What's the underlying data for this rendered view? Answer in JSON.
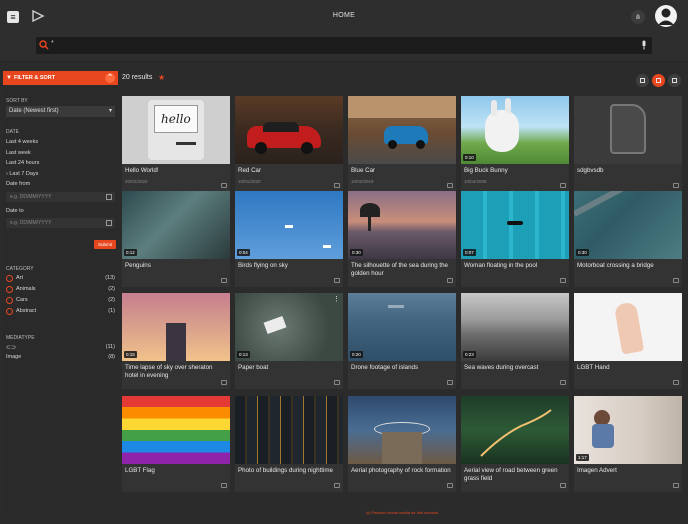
{
  "header": {
    "title": "HOME",
    "menu_icon": "hamburger-icon",
    "logo_icon": "play-logo-icon"
  },
  "search": {
    "value": "*",
    "placeholder": ""
  },
  "sidebar": {
    "panel_title": "FILTER & SORT",
    "sort_label": "SORT BY",
    "sort_value": "Date (Newest first)",
    "date_label": "DATE",
    "date_options": [
      "Last 4 weeks",
      "Last week",
      "Last 24 hours",
      "Last 7 Days"
    ],
    "date_from_label": "Date from",
    "date_from_placeholder": "e.g. DD/MM/YYYY",
    "date_to_label": "Date to",
    "date_to_placeholder": "e.g. DD/MM/YYYY",
    "submit_label": "Submit",
    "category_label": "CATEGORY",
    "categories": [
      {
        "name": "Art",
        "count": "(13)"
      },
      {
        "name": "Animals",
        "count": "(2)"
      },
      {
        "name": "Cars",
        "count": "(2)"
      },
      {
        "name": "Abstract",
        "count": "(1)"
      }
    ],
    "mediatype_label": "MEDIATYPE",
    "mediatypes": [
      {
        "name": "",
        "count": "(11)"
      },
      {
        "name": "Image",
        "count": "(8)"
      }
    ]
  },
  "main": {
    "results_count": "20 results",
    "cards": [
      {
        "title": "Hello World!",
        "date": "20/02/2020",
        "duration": "",
        "type": "image"
      },
      {
        "title": "Red Car",
        "date": "10/01/2020",
        "duration": "",
        "type": "image"
      },
      {
        "title": "Blue Car",
        "date": "10/02/2019",
        "duration": "",
        "type": "image"
      },
      {
        "title": "Big Buck Bunny",
        "date": "10/04/2008",
        "duration": "0:10",
        "type": "video"
      },
      {
        "title": "sdgbvsdb",
        "date": "",
        "duration": "",
        "type": "video"
      },
      {
        "title": "Penguins",
        "date": "",
        "duration": "0:12",
        "type": "video"
      },
      {
        "title": "Birds flying on sky",
        "date": "",
        "duration": "0:04",
        "type": "video"
      },
      {
        "title": "The silhouette of the sea during the golden hour",
        "date": "",
        "duration": "0:30",
        "type": "video"
      },
      {
        "title": "Woman floating in the pool",
        "date": "",
        "duration": "0:07",
        "type": "video"
      },
      {
        "title": "Motorboat crossing a bridge",
        "date": "",
        "duration": "0:30",
        "type": "video"
      },
      {
        "title": "Time lapse of sky over sheraton hotel in evening",
        "date": "",
        "duration": "0:15",
        "type": "video"
      },
      {
        "title": "Paper boat",
        "date": "",
        "duration": "0:13",
        "type": "video"
      },
      {
        "title": "Drone footage of islands",
        "date": "",
        "duration": "0:20",
        "type": "video"
      },
      {
        "title": "Sea waves during overcast",
        "date": "",
        "duration": "0:23",
        "type": "video"
      },
      {
        "title": "LGBT Hand",
        "date": "",
        "duration": "",
        "type": "image"
      },
      {
        "title": "LGBT Flag",
        "date": "",
        "duration": "",
        "type": "image"
      },
      {
        "title": "Photo of buildings during nighttime",
        "date": "",
        "duration": "",
        "type": "image"
      },
      {
        "title": "Aerial photography of rock formation",
        "date": "",
        "duration": "",
        "type": "image"
      },
      {
        "title": "Aerial view of road between green grass field",
        "date": "",
        "duration": "",
        "type": "image"
      },
      {
        "title": "Imagen Advert",
        "date": "",
        "duration": "1:17",
        "type": "video"
      }
    ]
  },
  "footer": {
    "text": "(c) Parsons virtual media for this account"
  },
  "colors": {
    "accent": "#e8461f",
    "background": "#2b2b2b",
    "card": "#333333"
  }
}
